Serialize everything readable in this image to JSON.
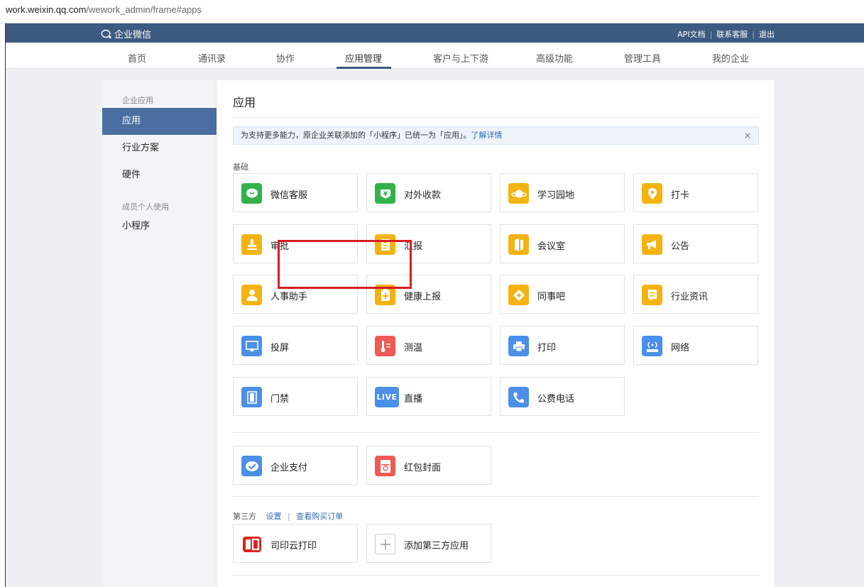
{
  "browser": {
    "url_host": "work.weixin.qq.com",
    "url_path": "/wework_admin/frame#apps"
  },
  "topbar": {
    "logo_text": "企业微信",
    "links": [
      "API文档",
      "联系客服",
      "退出"
    ]
  },
  "nav": {
    "items": [
      "首页",
      "通讯录",
      "协作",
      "应用管理",
      "客户与上下游",
      "高级功能",
      "管理工具",
      "我的企业"
    ],
    "active_index": 3
  },
  "sidebar": {
    "group1": "企业应用",
    "items1": [
      "应用",
      "行业方案",
      "硬件"
    ],
    "group2": "成员个人使用",
    "items2": [
      "小程序"
    ],
    "active": "应用"
  },
  "main": {
    "title": "应用",
    "notice": {
      "text": "为支持更多能力，原企业关联添加的「小程序」已统一为「应用」。",
      "link": "了解详情",
      "close": "×"
    },
    "basic_label": "基础",
    "basic_apps": [
      {
        "label": "微信客服",
        "icon": "wechat-service-icon",
        "color": "#33b24a"
      },
      {
        "label": "对外收款",
        "icon": "payment-icon",
        "color": "#33b24a"
      },
      {
        "label": "学习园地",
        "icon": "planet-icon",
        "color": "#f4b311"
      },
      {
        "label": "打卡",
        "icon": "location-pin-icon",
        "color": "#f4b311"
      },
      {
        "label": "审批",
        "icon": "stamp-icon",
        "color": "#f4b311"
      },
      {
        "label": "汇报",
        "icon": "report-icon",
        "color": "#f4b311"
      },
      {
        "label": "会议室",
        "icon": "door-icon",
        "color": "#f4b311"
      },
      {
        "label": "公告",
        "icon": "megaphone-icon",
        "color": "#f4b311"
      },
      {
        "label": "人事助手",
        "icon": "person-icon",
        "color": "#f4b311"
      },
      {
        "label": "健康上报",
        "icon": "health-report-icon",
        "color": "#f4b311"
      },
      {
        "label": "同事吧",
        "icon": "diamond-icon",
        "color": "#f4b311"
      },
      {
        "label": "行业资讯",
        "icon": "news-icon",
        "color": "#f4b311"
      },
      {
        "label": "投屏",
        "icon": "screen-cast-icon",
        "color": "#4a8fe8"
      },
      {
        "label": "测温",
        "icon": "thermometer-icon",
        "color": "#ef5a55"
      },
      {
        "label": "打印",
        "icon": "printer-icon",
        "color": "#4a8fe8"
      },
      {
        "label": "网络",
        "icon": "router-icon",
        "color": "#4a8fe8"
      },
      {
        "label": "门禁",
        "icon": "access-door-icon",
        "color": "#4a8fe8"
      },
      {
        "label": "直播",
        "icon": "live-icon",
        "color": "#4a8fe8",
        "icon_text": "LIVE"
      },
      {
        "label": "公费电话",
        "icon": "phone-icon",
        "color": "#4a8fe8"
      }
    ],
    "extra_apps": [
      {
        "label": "企业支付",
        "icon": "enterprise-pay-icon",
        "color": "#4a8fe8"
      },
      {
        "label": "红包封面",
        "icon": "red-packet-icon",
        "color": "#ef5a55"
      }
    ],
    "third_party": {
      "label": "第三方",
      "settings": "设置",
      "orders": "查看购买订单"
    },
    "third_apps": [
      {
        "label": "司印云打印",
        "icon": "siyin-logo-icon",
        "color": "#d8231b"
      },
      {
        "label": "添加第三方应用",
        "icon": "plus-icon",
        "color": "#ffffff"
      }
    ]
  }
}
